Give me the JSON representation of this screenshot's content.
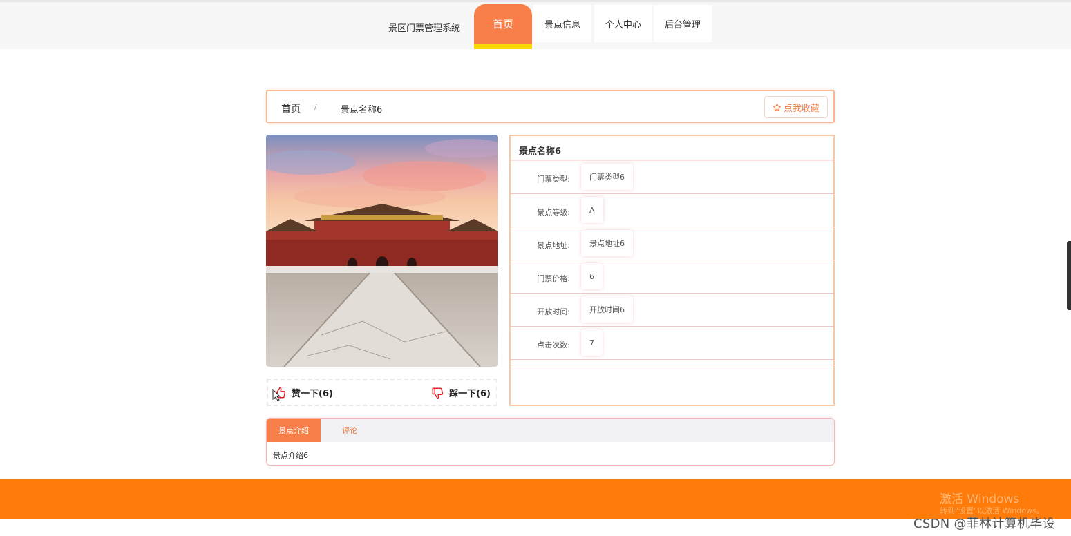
{
  "nav": {
    "brand": "景区门票管理系统",
    "items": [
      {
        "label": "首页",
        "active": true
      },
      {
        "label": "景点信息"
      },
      {
        "label": "个人中心"
      },
      {
        "label": "后台管理"
      }
    ]
  },
  "breadcrumb": {
    "home": "首页",
    "separator": "/",
    "current": "景点名称6"
  },
  "favorite_label": "点我收藏",
  "votes": {
    "like_label": "赞一下(6)",
    "dislike_label": "踩一下(6)"
  },
  "info": {
    "title": "景点名称6",
    "rows": [
      {
        "label": "门票类型:",
        "value": "门票类型6"
      },
      {
        "label": "景点等级:",
        "value": "A"
      },
      {
        "label": "景点地址:",
        "value": "景点地址6"
      },
      {
        "label": "门票价格:",
        "value": "6"
      },
      {
        "label": "开放时间:",
        "value": "开放时间6"
      },
      {
        "label": "点击次数:",
        "value": "7"
      }
    ]
  },
  "tabs": {
    "items": [
      {
        "label": "景点介绍",
        "active": true
      },
      {
        "label": "评论"
      }
    ],
    "content": "景点介绍6"
  },
  "overlay": {
    "windows_watermark": "激活 Windows",
    "windows_watermark_sub": "转到\"设置\"以激活 Windows。",
    "csdn": "CSDN @菲林计算机毕设"
  },
  "colors": {
    "accent": "#f87f4a",
    "footer": "#ff7c0a",
    "active_bar": "#ffd700"
  }
}
